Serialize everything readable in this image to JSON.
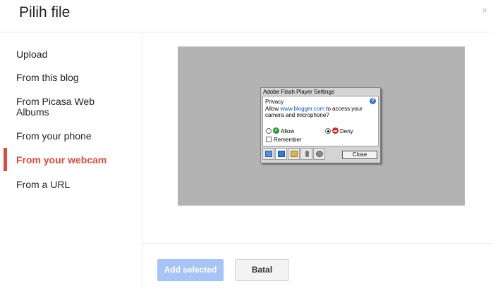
{
  "dialog": {
    "title": "Pilih file",
    "close_glyph": "×"
  },
  "sidebar": {
    "items": [
      {
        "label": "Upload"
      },
      {
        "label": "From this blog"
      },
      {
        "label": "From Picasa Web Albums"
      },
      {
        "label": "From your phone"
      },
      {
        "label": "From your webcam",
        "active": true
      },
      {
        "label": "From a URL"
      }
    ]
  },
  "flash_settings": {
    "title": "Adobe Flash Player Settings",
    "section": "Privacy",
    "help_glyph": "?",
    "message_prefix": "Allow ",
    "message_link": "www.blogger.com",
    "message_suffix": " to access your camera and microphone?",
    "allow_label": "Allow",
    "deny_label": "Deny",
    "selected_option": "Deny",
    "remember_label": "Remember",
    "remember_checked": false,
    "close_label": "Close",
    "tabs": [
      "display-tab",
      "privacy-tab",
      "storage-tab",
      "microphone-tab",
      "camera-tab"
    ],
    "selected_tab": "privacy-tab"
  },
  "footer": {
    "add_selected_label": "Add selected",
    "cancel_label": "Batal"
  },
  "colors": {
    "accent_active": "#dd4b39",
    "add_button_disabled": "#a6c4f5",
    "webcam_background": "#b3b3b3"
  }
}
